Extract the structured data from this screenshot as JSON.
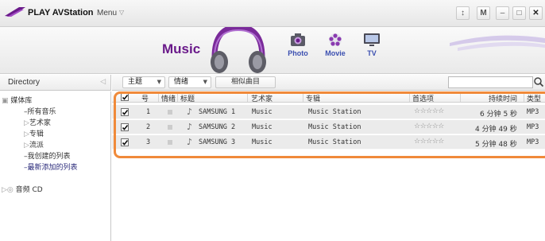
{
  "app": {
    "title": "PLAY AVStation",
    "menu_label": "Menu",
    "window_buttons": [
      "↕",
      "M",
      "–",
      "□",
      "✕"
    ]
  },
  "banner": {
    "current": "Music",
    "tabs": [
      {
        "label": "Photo",
        "icon": "camera-icon"
      },
      {
        "label": "Movie",
        "icon": "film-reel-icon"
      },
      {
        "label": "TV",
        "icon": "tv-icon"
      }
    ]
  },
  "directory": {
    "title": "Directory",
    "tree": {
      "root": "媒体库",
      "items": [
        {
          "label": "所有音乐",
          "prefix": "–"
        },
        {
          "label": "艺术家",
          "prefix": "▷"
        },
        {
          "label": "专辑",
          "prefix": "▷"
        },
        {
          "label": "流派",
          "prefix": "▷"
        },
        {
          "label": "我创建的列表",
          "prefix": "–"
        },
        {
          "label": "最新添加的列表",
          "prefix": "–"
        }
      ],
      "cd": "音频 CD"
    }
  },
  "toolbar": {
    "theme_label": "主题",
    "mood_label": "情绪",
    "similar_label": "相似曲目",
    "search_placeholder": ""
  },
  "table": {
    "columns": {
      "number": "号",
      "mood": "情绪",
      "title": "标题",
      "artist": "艺术家",
      "album": "专辑",
      "rating": "首选项",
      "duration": "持续时间",
      "type": "类型"
    },
    "rows": [
      {
        "number": "1",
        "title": "SAMSUNG 1",
        "artist": "Music",
        "album": "Music Station",
        "rating": "☆☆☆☆☆",
        "duration": "6 分钟 5 秒",
        "type": "MP3",
        "checked": true
      },
      {
        "number": "2",
        "title": "SAMSUNG 2",
        "artist": "Music",
        "album": "Music Station",
        "rating": "☆☆☆☆☆",
        "duration": "4 分钟 49 秒",
        "type": "MP3",
        "checked": true
      },
      {
        "number": "3",
        "title": "SAMSUNG 3",
        "artist": "Music",
        "album": "Music Station",
        "rating": "☆☆☆☆☆",
        "duration": "5 分钟 48 秒",
        "type": "MP3",
        "checked": true
      }
    ]
  },
  "colors": {
    "accent_purple": "#6a1a8a",
    "nav_blue": "#3b4fb0",
    "highlight_orange": "#f08a3a"
  }
}
